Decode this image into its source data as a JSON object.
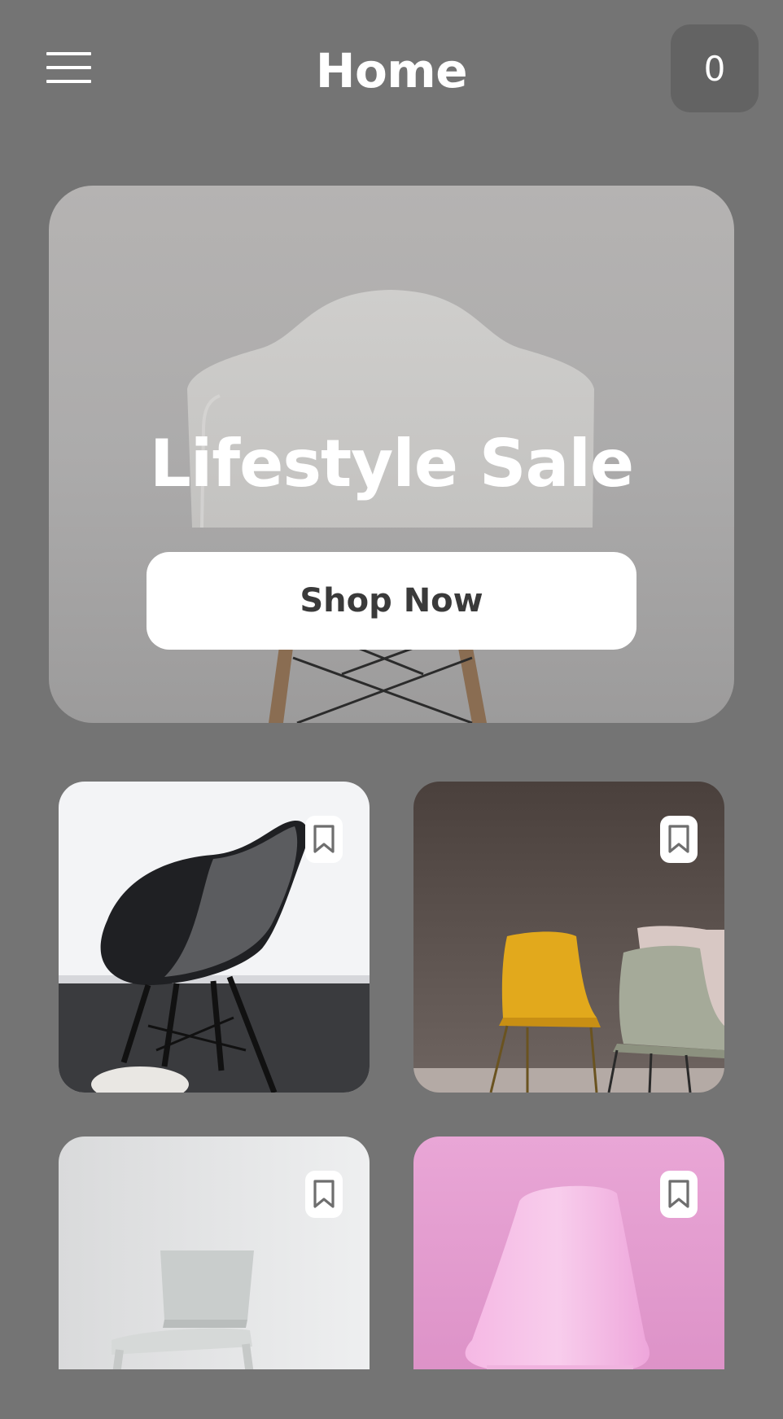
{
  "header": {
    "menu_icon": "hamburger-menu-icon",
    "title": "Home",
    "cart_count": "0"
  },
  "hero": {
    "title": "Lifestyle Sale",
    "button_label": "Shop Now",
    "image": "white-chair-photo"
  },
  "products": [
    {
      "image": "black-armchair-photo",
      "bookmark_icon": "bookmark-icon"
    },
    {
      "image": "yellow-and-sage-chairs-photo",
      "bookmark_icon": "bookmark-icon"
    },
    {
      "image": "white-chair-photo",
      "bookmark_icon": "bookmark-icon"
    },
    {
      "image": "pink-chair-shell-photo",
      "bookmark_icon": "bookmark-icon"
    }
  ],
  "colors": {
    "background": "#747474",
    "cart_badge": "#636363",
    "button_text": "#3a3a3a",
    "bookmark_stroke": "#6e6e6e"
  }
}
